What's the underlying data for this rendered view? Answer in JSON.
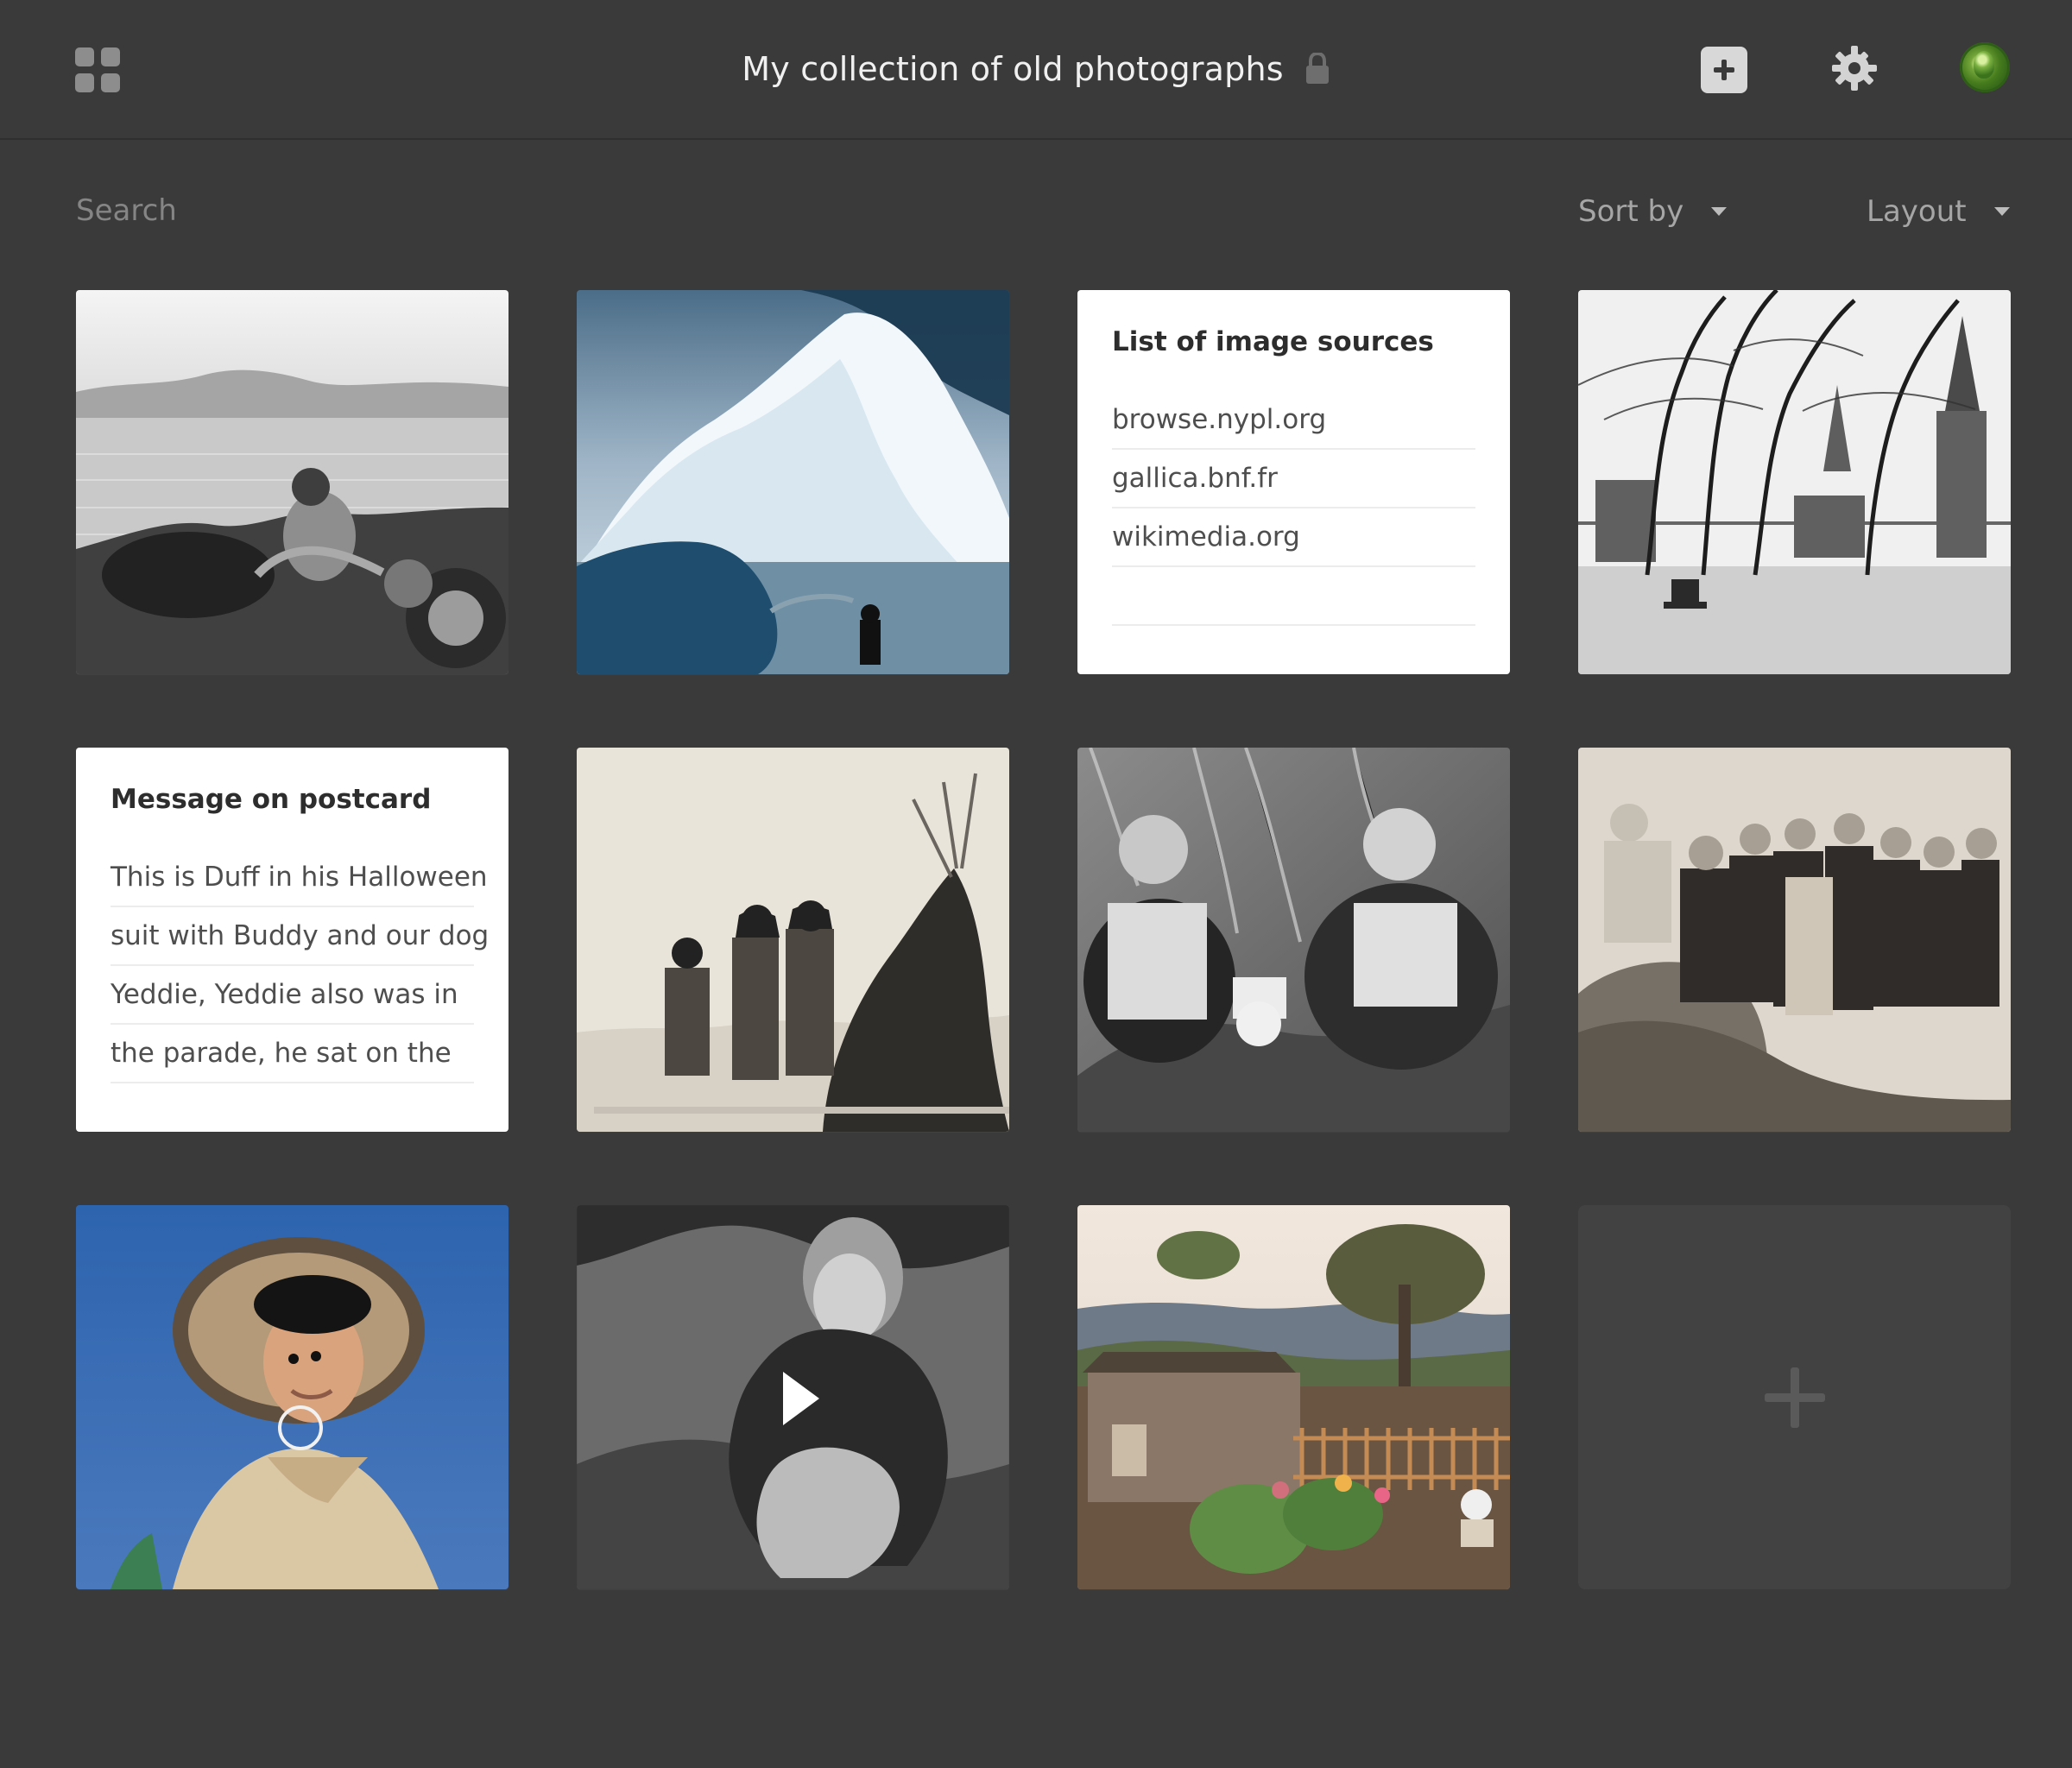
{
  "header": {
    "title": "My collection of old photographs",
    "menu_icon": "grid-icon",
    "lock_icon": "lock-icon",
    "add_icon": "add-icon",
    "settings_icon": "gear-icon",
    "avatar_icon": "avatar-icon"
  },
  "controls": {
    "search_placeholder": "Search",
    "sort_label": "Sort by",
    "layout_label": "Layout"
  },
  "tiles": [
    {
      "kind": "photo",
      "name": "photo-motorcycle-woman"
    },
    {
      "kind": "photo",
      "name": "photo-glacier"
    },
    {
      "kind": "note",
      "title": "List of image sources",
      "lines": [
        "browse.nypl.org",
        "gallica.bnf.fr",
        "wikimedia.org",
        ""
      ]
    },
    {
      "kind": "photo",
      "name": "photo-town-square"
    },
    {
      "kind": "note",
      "title": "Message on postcard",
      "lines": [
        "This is Duff in his Halloween",
        "suit with Buddy and our dog",
        "Yeddie, Yeddie also was in",
        "the parade, he sat on the"
      ]
    },
    {
      "kind": "photo",
      "name": "photo-sami-tent"
    },
    {
      "kind": "photo",
      "name": "photo-two-men-picnic"
    },
    {
      "kind": "photo",
      "name": "photo-group-on-rocks"
    },
    {
      "kind": "photo",
      "name": "photo-woman-hat"
    },
    {
      "kind": "video",
      "name": "photo-woman-kneeling-video"
    },
    {
      "kind": "photo",
      "name": "photo-cabin-garden"
    },
    {
      "kind": "add",
      "name": "add-tile"
    }
  ],
  "colors": {
    "background": "#3a3a3a",
    "card": "#ffffff",
    "muted": "#858585"
  }
}
